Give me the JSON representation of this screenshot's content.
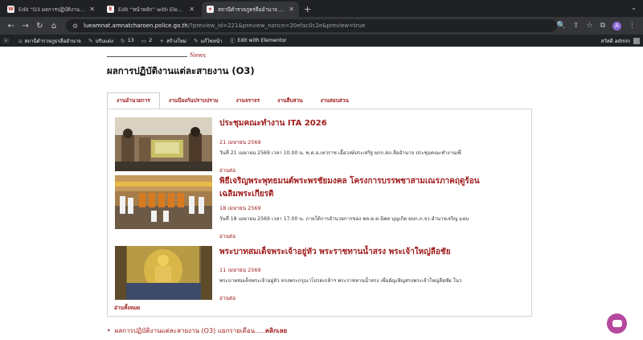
{
  "browser": {
    "tabs": [
      {
        "title": "Edit “O3 ผลการปฏิบัติงานแต่ละสาย",
        "active": false
      },
      {
        "title": "Edit “หน้าหลัก” with Elementor",
        "active": false
      },
      {
        "title": "สถานีตำรวจภูธรลืออำนาจ – Luean",
        "active": true
      }
    ],
    "url_host": "lueamnat.amnatcharoen.police.go.th",
    "url_rest": "/?preview_id=221&preview_nonce=20efac0c2e&preview=true",
    "profile_initial": "A"
  },
  "adminbar": {
    "site_name": "สถานีตำรวจภูธรลืออำนาจ",
    "customize": "ปรับแต่ง",
    "updates_count": "13",
    "comments_count": "2",
    "new_label": "สร้างใหม่",
    "edit_page": "แก้ไขหน้า",
    "elementor": "Edit with Elementor",
    "greeting": "สวัสดี admin"
  },
  "page": {
    "kicker": "News",
    "title": "ผลการปฏิบัติงานแต่ละสายงาน (O3)",
    "tabs": [
      "งานอำนวยการ",
      "งานป้องกันปราบปราม",
      "งานจราจร",
      "งานสืบสวน",
      "งานสอบสวน"
    ],
    "active_tab": 0,
    "items": [
      {
        "title": "ประชุมคณะทำงาน ITA 2026",
        "date": "21 เมษายน 2569",
        "excerpt": "วันที่ 21 เมษายน 2569 เวลา 10.00 น. พ.ต.อ.เทวราช เอื้อวงษ์ประเสริฐ ผกก.สภ.ลืออำนาจ ประชุมคณะทำงานเพื่",
        "more": "อ่านต่อ"
      },
      {
        "title": "พิธีเจริญพระพุทธมนต์พระพรชัยมงคล โครงการบรรพชาสามเณรภาคฤดูร้อนเฉลิมพระเกียรติ",
        "date": "18 เมษายน 2569",
        "excerpt": "วันที่ 18 เมษายน 2569 เวลา 17.00 น. ภายใต้การอำนวยการของ พล.ต.ต.นิพล บุญเกิด ผบก.ภ.จว.อำนาจเจริญ มอบ",
        "more": "อ่านต่อ"
      },
      {
        "title": "พระบาทสมเด็จพระเจ้าอยู่หัว พระราชทานน้ำสรง พระเจ้าใหญ่ลือชัย",
        "date": "11 เมษายน 2569",
        "excerpt": "พระบาทสมเด็จพระเจ้าอยู่หัว ทรงพระกรุณาโปรดเกล้าฯ พระราชทานน้ำสรง เพื่ออัญเชิญสรงพระเจ้าใหญ่ลือชัย ในว",
        "more": "อ่านต่อ"
      }
    ],
    "view_all": "อ่านทั้งหมด",
    "monthly_text": "ผลการปฏิบัติงานแต่ละสายงาน (O3) แยกรายเดือน.....",
    "monthly_click": "คลิกเลย"
  },
  "colors": {
    "accent": "#a01c1c",
    "adminbar": "#1d2327",
    "chat": "#b5489e"
  }
}
